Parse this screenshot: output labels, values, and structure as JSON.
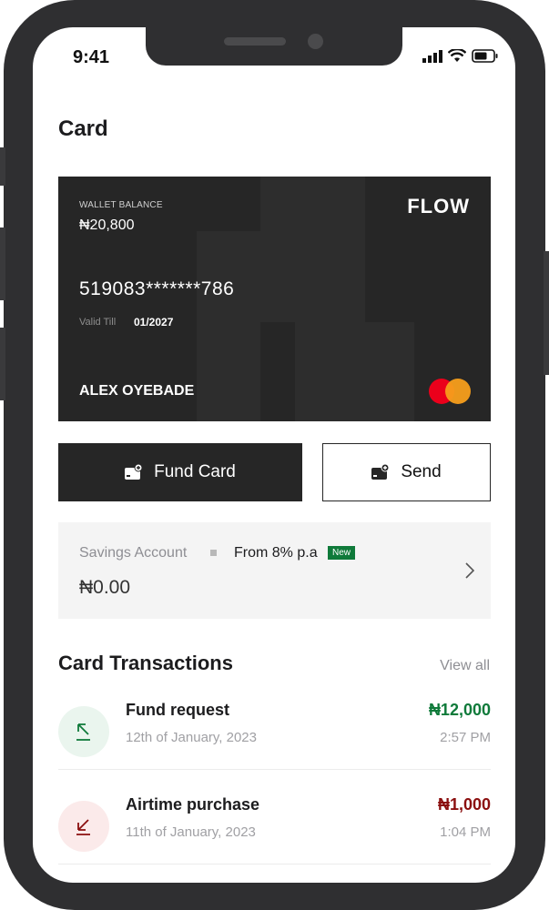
{
  "status_bar": {
    "time": "9:41"
  },
  "page": {
    "title": "Card"
  },
  "card": {
    "wallet_label": "WALLET BALANCE",
    "wallet_balance": "₦20,800",
    "brand": "FLOW",
    "number": "519083*******786",
    "valid_label": "Valid Till",
    "valid_value": "01/2027",
    "holder": "ALEX OYEBADE"
  },
  "actions": {
    "fund_label": "Fund Card",
    "send_label": "Send"
  },
  "savings": {
    "label": "Savings Account",
    "rate": "From 8% p.a",
    "badge": "New",
    "balance": "₦0.00"
  },
  "transactions": {
    "title": "Card Transactions",
    "view_all": "View all",
    "items": [
      {
        "name": "Fund request",
        "date": "12th of January, 2023",
        "amount": "₦12,000",
        "time": "2:57 PM",
        "type": "credit"
      },
      {
        "name": "Airtime purchase",
        "date": "11th of January, 2023",
        "amount": "₦1,000",
        "time": "1:04 PM",
        "type": "debit"
      }
    ]
  },
  "colors": {
    "credit": "#0f7a3a",
    "debit": "#8b0f0f",
    "credit_bg": "#eaf5ee",
    "debit_bg": "#fbeaea",
    "card_bg": "#262626"
  }
}
